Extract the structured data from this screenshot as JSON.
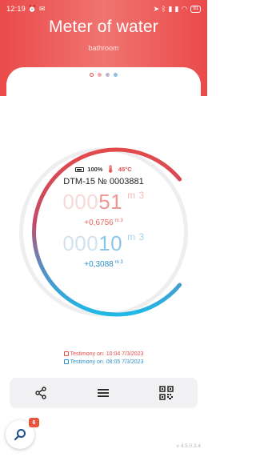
{
  "status_bar": {
    "time": "12:19",
    "battery": "91"
  },
  "header": {
    "title": "Meter of water",
    "subtitle": "bathroom"
  },
  "meter": {
    "battery": "100%",
    "temperature": "45°C",
    "device_id": "DTM-15 № 0003881",
    "hot": {
      "reading_prefix": "000",
      "reading_main": "51",
      "unit": "m",
      "unit_exp": "3",
      "delta": "+0,6756",
      "delta_unit": "m",
      "delta_exp": "3"
    },
    "cold": {
      "reading_prefix": "000",
      "reading_main": "10",
      "unit": "m",
      "unit_exp": "3",
      "delta": "+0,3088",
      "delta_unit": "m",
      "delta_exp": "3"
    }
  },
  "testimony": {
    "hot": "Testimony on: 10:04 7/3/2023",
    "cold": "Testimony on: 08:05 7/3/2023"
  },
  "fab": {
    "badge": "6"
  },
  "version": "v 4.5.0.3.4",
  "colors": {
    "accent": "#ea4a4a",
    "cold": "#2f8fc9",
    "gauge_start": "#e34a4a",
    "gauge_end": "#20b8e6"
  }
}
